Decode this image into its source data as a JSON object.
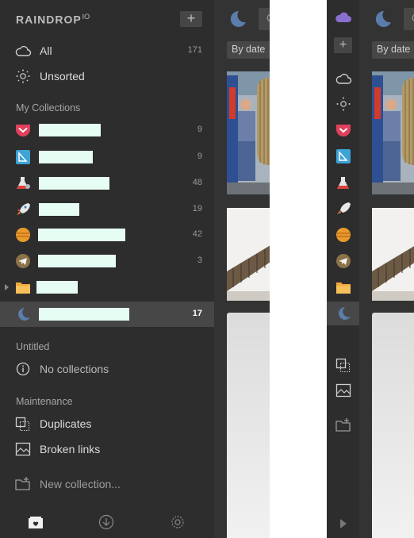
{
  "brand": {
    "name": "RAINDROP",
    "version": "IO"
  },
  "sidebar": {
    "all": {
      "label": "All",
      "count": "171"
    },
    "unsorted": {
      "label": "Unsorted"
    },
    "my_collections_heading": "My Collections",
    "collections": [
      {
        "icon": "pocket-icon",
        "count": "9"
      },
      {
        "icon": "bookmark-book-icon",
        "count": "9"
      },
      {
        "icon": "lab-flask-icon",
        "count": "48"
      },
      {
        "icon": "rocket-icon",
        "count": "19"
      },
      {
        "icon": "planet-icon",
        "count": "42"
      },
      {
        "icon": "telegram-icon",
        "count": "3"
      },
      {
        "icon": "folder-icon",
        "count": ""
      },
      {
        "icon": "moon-icon",
        "count": "17"
      }
    ],
    "untitled_heading": "Untitled",
    "no_collections": "No collections",
    "maintenance_heading": "Maintenance",
    "duplicates": "Duplicates",
    "broken_links": "Broken links",
    "new_collection": "New collection..."
  },
  "content": {
    "sort_label": "By date",
    "search_placeholder": "C"
  },
  "colors": {
    "sidebar_bg": "#2d2d2d",
    "active_bg": "#474747",
    "redaction": "#e5fdf2",
    "accent_moon": "#5a7dac"
  }
}
